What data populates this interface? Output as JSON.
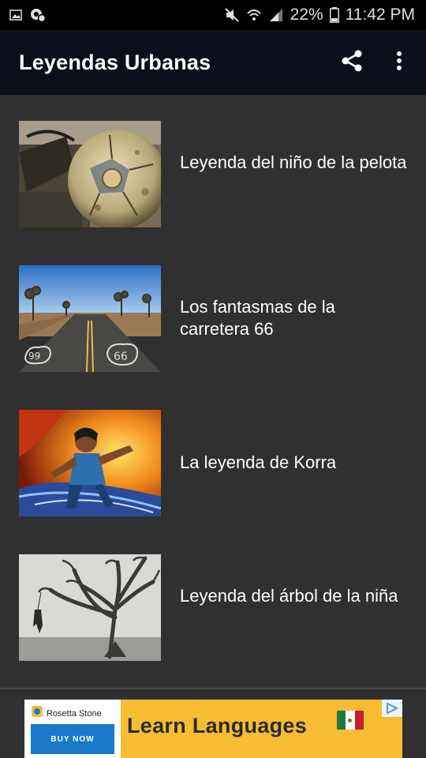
{
  "status_bar": {
    "battery": "22%",
    "time": "11:42 PM",
    "icons": [
      "image-notification-icon",
      "settings-notification-icon",
      "mute-icon",
      "wifi-icon",
      "signal-icon",
      "battery-icon"
    ]
  },
  "app_bar": {
    "title": "Leyendas Urbanas",
    "actions": [
      "share-icon",
      "more-vert-icon"
    ],
    "background": "#0c0f1a"
  },
  "list": {
    "background": "#303030",
    "items": [
      {
        "label": "Leyenda del niño de la pelota",
        "thumbnail": "soccer-ball-image"
      },
      {
        "label": "Los fantasmas de la carretera 66",
        "thumbnail": "route-66-image"
      },
      {
        "label": "La leyenda de Korra",
        "thumbnail": "korra-image"
      },
      {
        "label": "Leyenda del árbol de la niña",
        "thumbnail": "tree-image"
      }
    ]
  },
  "ad": {
    "brand": "Rosetta Stone",
    "cta": "BUY NOW",
    "headline": "Learn Languages",
    "accent": "#f5bc34",
    "cta_color": "#1a7ac9"
  }
}
